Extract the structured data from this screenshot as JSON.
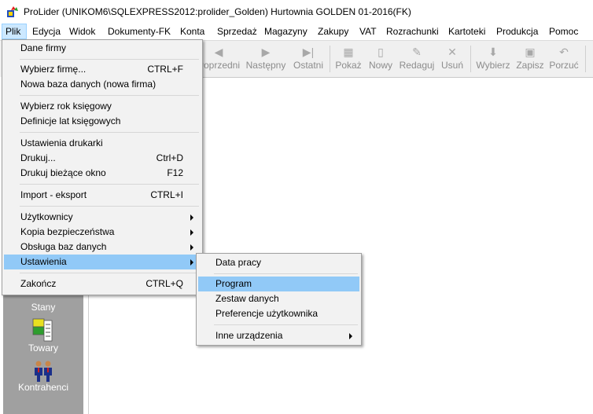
{
  "window": {
    "title": "ProLider  (UNIKOM6\\SQLEXPRESS2012:prolider_Golden) Hurtownia GOLDEN 01-2016(FK)"
  },
  "menubar": {
    "items": [
      "Plik",
      "Edycja",
      "Widok",
      "Dokumenty-FK",
      "Konta",
      "Sprzedaż",
      "Magazyny",
      "Zakupy",
      "VAT",
      "Rozrachunki",
      "Kartoteki",
      "Produkcja",
      "Pomoc"
    ],
    "active": "Plik"
  },
  "toolbar": {
    "buttons": [
      "Poprzedni",
      "Następny",
      "Ostatni",
      "Pokaż",
      "Nowy",
      "Redaguj",
      "Usuń",
      "Wybierz",
      "Zapisz",
      "Porzuć"
    ],
    "icons": [
      "previous-icon",
      "next-icon",
      "last-icon",
      "show-icon",
      "new-icon",
      "edit-icon",
      "delete-icon",
      "select-icon",
      "save-icon",
      "undo-icon"
    ]
  },
  "sidebar": {
    "items": [
      {
        "label": "Stany",
        "icon": "stock-icon"
      },
      {
        "label": "Towary",
        "icon": "goods-icon"
      },
      {
        "label": "Kontrahenci",
        "icon": "contractors-icon"
      }
    ]
  },
  "plik_menu": {
    "items": [
      {
        "label": "Dane firmy",
        "shortcut": ""
      },
      {
        "label": "Wybierz firmę...",
        "shortcut": "CTRL+F"
      },
      {
        "label": "Nowa baza danych (nowa firma)",
        "shortcut": ""
      },
      {
        "label": "Wybierz rok księgowy",
        "shortcut": ""
      },
      {
        "label": "Definicje lat księgowych",
        "shortcut": ""
      },
      {
        "label": "Ustawienia drukarki",
        "shortcut": ""
      },
      {
        "label": "Drukuj...",
        "shortcut": "Ctrl+D"
      },
      {
        "label": "Drukuj bieżące okno",
        "shortcut": "F12"
      },
      {
        "label": "Import - eksport",
        "shortcut": "CTRL+I"
      },
      {
        "label": "Użytkownicy",
        "shortcut": ""
      },
      {
        "label": "Kopia bezpieczeństwa",
        "shortcut": ""
      },
      {
        "label": "Obsługa baz danych",
        "shortcut": ""
      },
      {
        "label": "Ustawienia",
        "shortcut": ""
      },
      {
        "label": "Zakończ",
        "shortcut": "CTRL+Q"
      }
    ]
  },
  "ustawienia_submenu": {
    "items": [
      "Data pracy",
      "Program",
      "Zestaw danych",
      "Preferencje użytkownika",
      "Inne urządzenia"
    ],
    "highlighted": "Program"
  },
  "colors": {
    "highlight": "#91c9f7",
    "sidebar_bg": "#a0a0a0",
    "toolbar_bg": "#f0f0f0",
    "menu_bg": "#f2f2f2"
  }
}
